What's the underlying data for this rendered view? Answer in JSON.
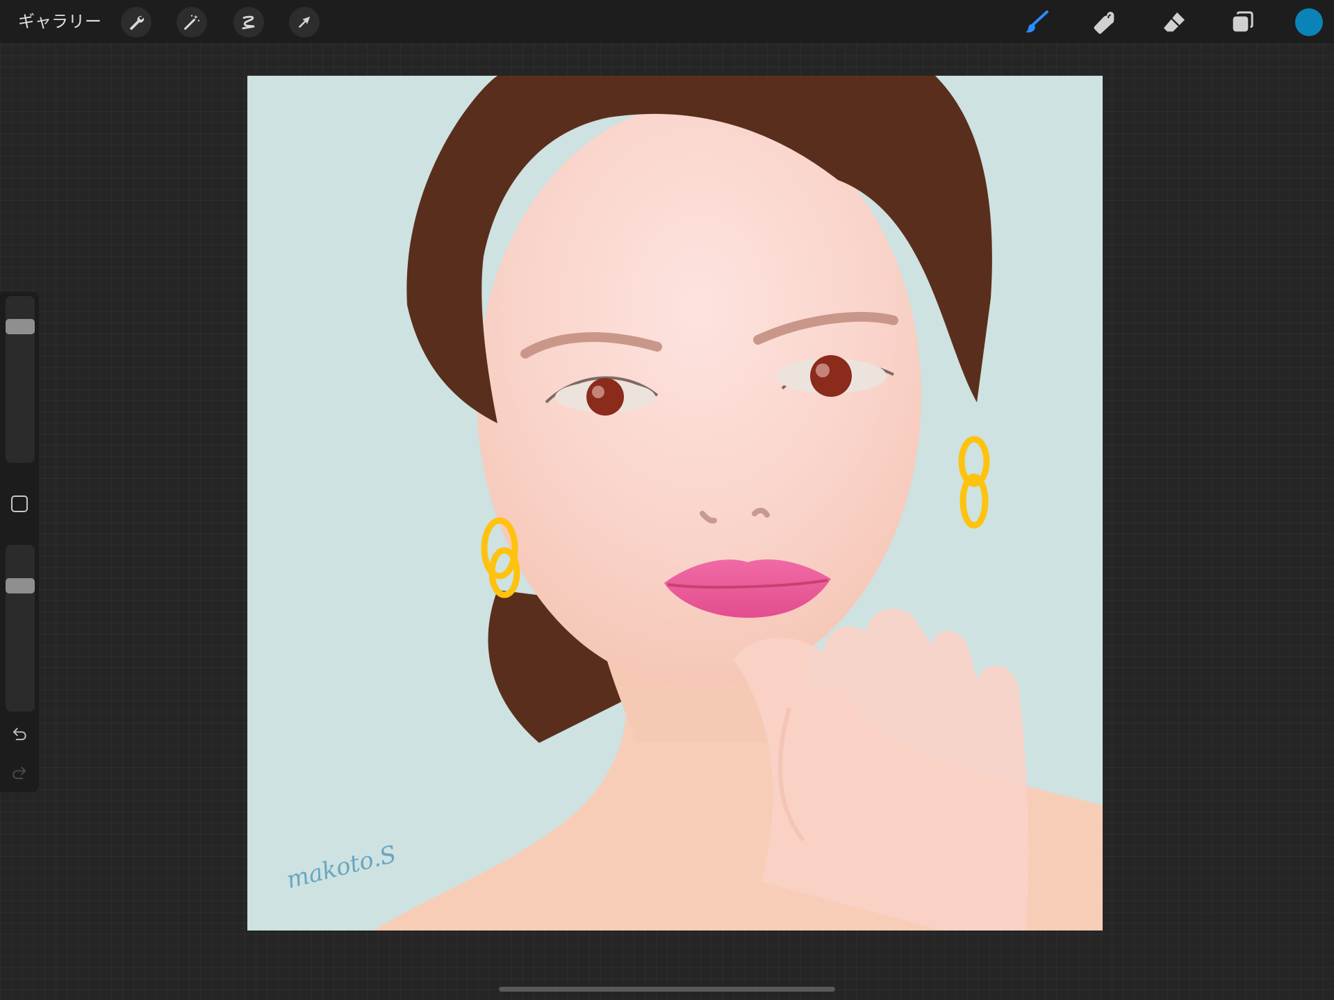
{
  "topbar": {
    "gallery_label": "ギャラリー"
  },
  "tools": {
    "left": [
      {
        "name": "actions",
        "icon": "wrench-icon"
      },
      {
        "name": "adjustments",
        "icon": "magic-wand-icon"
      },
      {
        "name": "selection",
        "icon": "selection-s-icon"
      },
      {
        "name": "transform",
        "icon": "arrow-cursor-icon"
      }
    ],
    "right": [
      {
        "name": "paint",
        "icon": "brush-icon",
        "active": true
      },
      {
        "name": "smudge",
        "icon": "smudge-finger-icon"
      },
      {
        "name": "erase",
        "icon": "eraser-icon"
      },
      {
        "name": "layers",
        "icon": "layers-icon"
      }
    ]
  },
  "current_color": "#0a84b8",
  "active_tool_color": "#2a8cff",
  "sidebar": {
    "brush_size_level": 0.85,
    "opacity_level": 0.78
  },
  "artwork": {
    "signature": "makoto.S",
    "background_color": "#cde2e1",
    "hair_color": "#5a2e1c",
    "skin_color": "#f9d3c9",
    "lip_color": "#ec5a9a",
    "earring_color": "#ffc20e"
  }
}
